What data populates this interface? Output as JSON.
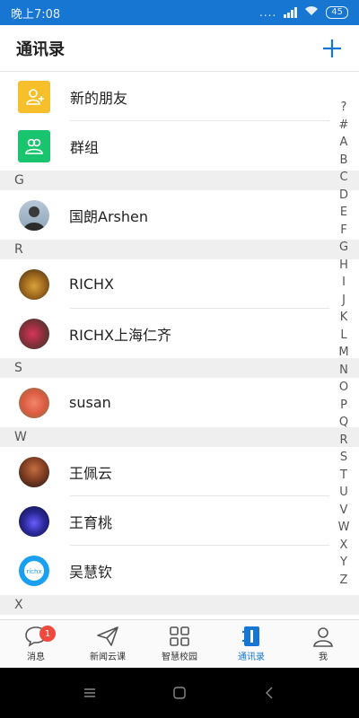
{
  "status_bar": {
    "time": "晚上7:08",
    "signal_dots": "....",
    "battery": "45"
  },
  "header": {
    "title": "通讯录"
  },
  "special_items": [
    {
      "label": "新的朋友",
      "icon": "add-friend-icon",
      "color": "#f7c02b"
    },
    {
      "label": "群组",
      "icon": "group-icon",
      "color": "#19c46e"
    }
  ],
  "sections": [
    {
      "letter": "G",
      "contacts": [
        {
          "name": "国朗Arshen"
        }
      ]
    },
    {
      "letter": "R",
      "contacts": [
        {
          "name": "RICHX"
        },
        {
          "name": "RICHX上海仁齐"
        }
      ]
    },
    {
      "letter": "S",
      "contacts": [
        {
          "name": "susan"
        }
      ]
    },
    {
      "letter": "W",
      "contacts": [
        {
          "name": "王佩云"
        },
        {
          "name": "王育桃"
        },
        {
          "name": "吴慧钦"
        }
      ]
    },
    {
      "letter": "X",
      "contacts": []
    }
  ],
  "avatar_logo_text": "richx",
  "alphabet_index": [
    "?",
    "#",
    "A",
    "B",
    "C",
    "D",
    "E",
    "F",
    "G",
    "H",
    "I",
    "J",
    "K",
    "L",
    "M",
    "N",
    "O",
    "P",
    "Q",
    "R",
    "S",
    "T",
    "U",
    "V",
    "W",
    "X",
    "Y",
    "Z"
  ],
  "tabs": [
    {
      "label": "消息",
      "badge": "1"
    },
    {
      "label": "新闻云课"
    },
    {
      "label": "智慧校园"
    },
    {
      "label": "通讯录",
      "active": true
    },
    {
      "label": "我"
    }
  ],
  "colors": {
    "accent": "#1776d2",
    "badge": "#f04a3f",
    "section_bg": "#efefef"
  }
}
